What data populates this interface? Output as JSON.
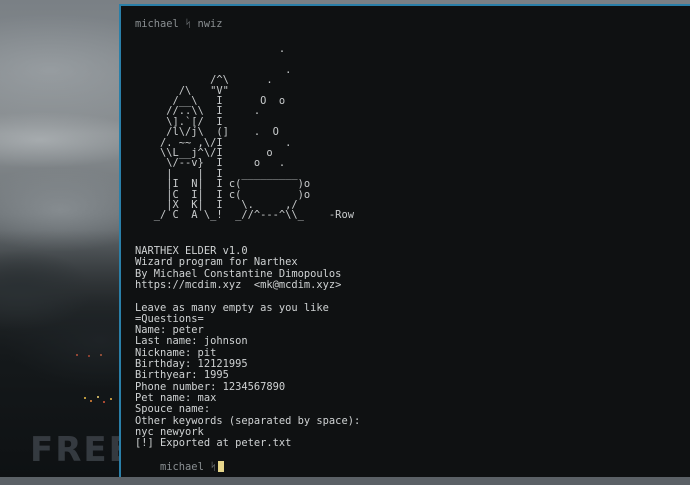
{
  "terminal": {
    "prompt_top": "michael ᛋ nwiz",
    "ascii_art": [
      "                       .",
      "",
      "                        .",
      "            /^\\      .",
      "       /\\   \"V\"",
      "      /__\\   I      O  o",
      "     //..\\\\  I     .",
      "     \\].`[/  I",
      "     /l\\/j\\  (]    .  O",
      "    /. ~~ ,\\/I          .",
      "    \\\\L__j^\\/I       o",
      "     \\/--v}  I     o   .",
      "     |    |  I   _________",
      "     |I  N|  I c(         )o",
      "     |C  I|  I c(         )o",
      "     |X  K|  I   \\.     ,/",
      "   _/ C  A \\_!  _//^---^\\\\_    -Row"
    ],
    "output_lines": [
      "NARTHEX ELDER v1.0",
      "Wizard program for Narthex",
      "By Michael Constantine Dimopoulos",
      "https://mcdim.xyz  <mk@mcdim.xyz>",
      "",
      "Leave as many empty as you like",
      "=Questions=",
      "Name: peter",
      "Last name: johnson",
      "Nickname: pit",
      "Birthday: 12121995",
      "Birthyear: 1995",
      "Phone number: 1234567890",
      "Pet name: max",
      "Spouce name:",
      "Other keywords (separated by space):",
      "nyc newyork",
      "[!] Exported at peter.txt"
    ],
    "prompt_bottom": "michael ᛋ"
  },
  "watermark": {
    "text": "FREEBUF"
  },
  "colors": {
    "terminal_bg": "#0f1112",
    "terminal_fg": "#cfd2d3",
    "border_accent": "#2a7fa8",
    "cursor": "#e6d58a"
  }
}
